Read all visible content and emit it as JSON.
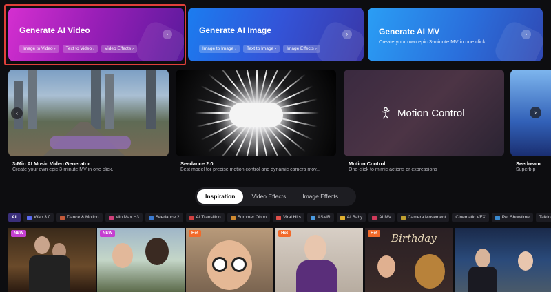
{
  "hero": [
    {
      "title": "Generate AI Video",
      "chips": [
        "Image to Video",
        "Text to Video",
        "Video Effects"
      ]
    },
    {
      "title": "Generate AI Image",
      "chips": [
        "Image to Image",
        "Text to Image",
        "Image Effects"
      ]
    },
    {
      "title": "Generate AI MV",
      "subtitle": "Create your own epic 3-minute MV in one click."
    }
  ],
  "features": [
    {
      "title": "3-Min AI Music Video Generator",
      "desc": "Create your own epic 3-minute MV in one click."
    },
    {
      "title": "Seedance 2.0",
      "desc": "Best model for precise motion control and dynamic camera mov..."
    },
    {
      "title": "Motion Control",
      "desc": "One-click to mimic actions or expressions",
      "overlay": "Motion Control"
    },
    {
      "title": "Seedream",
      "desc": "Superb p"
    }
  ],
  "tabs": [
    "Inspiration",
    "Video Effects",
    "Image Effects"
  ],
  "active_tab": "Inspiration",
  "filters": [
    "All",
    "Wan 3.0",
    "Dance & Motion",
    "MiniMax H3",
    "Seedance 2",
    "AI Transition",
    "Summer Obon",
    "Viral Hits",
    "ASMR",
    "AI Baby",
    "AI MV",
    "Camera Movement",
    "Cinematic VFX",
    "Pet Showtime",
    "Talking"
  ],
  "gallery_tags": [
    "NEW",
    "NEW",
    "Hot",
    "Hot",
    "Hot",
    ""
  ],
  "gallery_text": {
    "birthday": "Birthday"
  },
  "colors": {
    "accent_selected": "#e0403a",
    "new_tag": "#c53fd1",
    "hot_tag": "#f26a2a"
  },
  "icons": {
    "arrow": "›",
    "left": "‹"
  }
}
